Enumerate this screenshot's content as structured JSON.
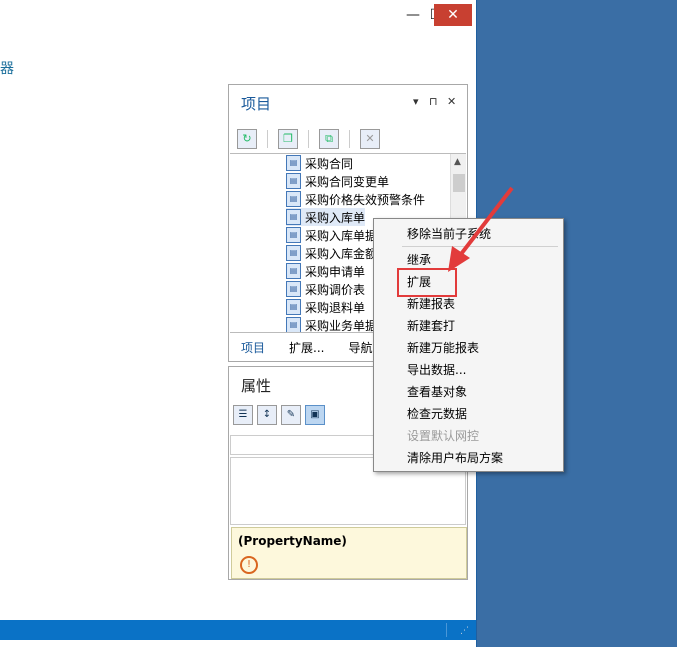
{
  "window": {
    "fragment_text": "器"
  },
  "project_panel": {
    "title": "项目",
    "items": [
      "采购合同",
      "采购合同变更单",
      "采购价格失效预警条件",
      "采购入库单",
      "采购入库单据",
      "采购入库金额",
      "采购申请单",
      "采购调价表",
      "采购退料单",
      "采购业务单据"
    ],
    "tabs": [
      "项目",
      "扩展...",
      "导航"
    ]
  },
  "properties_panel": {
    "title": "属性",
    "description_title": "(PropertyName)"
  },
  "context_menu": {
    "items": [
      {
        "label": "移除当前子系统",
        "enabled": true
      },
      {
        "label": "继承",
        "enabled": true
      },
      {
        "label": "扩展",
        "enabled": true
      },
      {
        "label": "新建报表",
        "enabled": true
      },
      {
        "label": "新建套打",
        "enabled": true
      },
      {
        "label": "新建万能报表",
        "enabled": true
      },
      {
        "label": "导出数据...",
        "enabled": true
      },
      {
        "label": "查看基对象",
        "enabled": true
      },
      {
        "label": "检查元数据",
        "enabled": true
      },
      {
        "label": "设置默认网控",
        "enabled": false
      },
      {
        "label": "清除用户布局方案",
        "enabled": true
      }
    ]
  },
  "colors": {
    "desktop": "#3a6ea5",
    "statusbar": "#0a72c6",
    "close_button": "#c84031",
    "highlight_box": "#e23b3b"
  }
}
